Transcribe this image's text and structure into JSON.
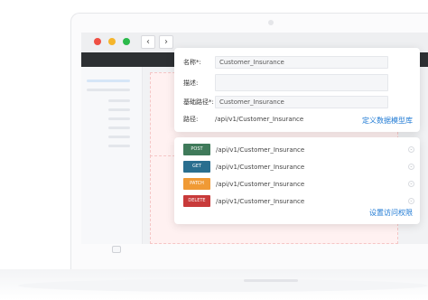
{
  "browser": {
    "back_glyph": "‹",
    "forward_glyph": "›",
    "colors": {
      "red": "#ef4f43",
      "yellow": "#f5b52b",
      "green": "#2bb94a",
      "topbar": "#2d3033"
    }
  },
  "model_form": {
    "name_label": "名称*:",
    "name_value": "Customer_Insurance",
    "description_label": "描述:",
    "description_value": "",
    "base_path_label": "基础路径*:",
    "base_path_value": "Customer_Insurance",
    "path_label": "路径:",
    "path_value": "/api/v1/Customer_Insurance",
    "action_link": "定义数据模型库"
  },
  "api_list": {
    "items": [
      {
        "method": "POST",
        "path": "/api/v1/Customer_Insurance",
        "color": "#3f7a5a"
      },
      {
        "method": "GET",
        "path": "/api/v1/Customer_Insurance",
        "color": "#2a6e8f"
      },
      {
        "method": "PATCH",
        "path": "/api/v1/Customer_Insurance",
        "color": "#f09a35"
      },
      {
        "method": "DELETE",
        "path": "/api/v1/Customer_Insurance",
        "color": "#c83a3a"
      }
    ],
    "action_link": "设置访问权限",
    "expand_icon": "chevron-down-icon",
    "link_color": "#1f7ad4"
  }
}
